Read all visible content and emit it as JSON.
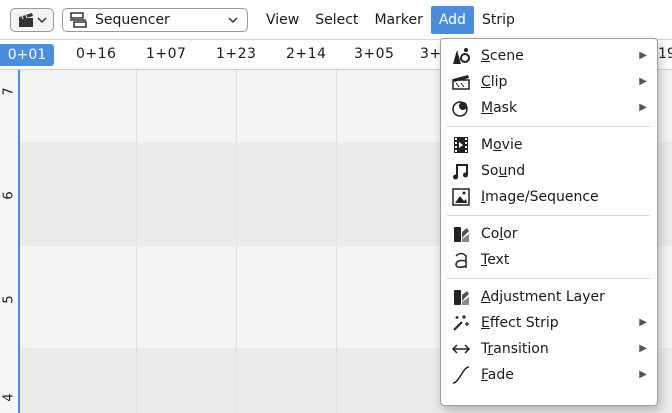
{
  "header": {
    "editor_type_icon": "clapperboard-icon",
    "mode_icon": "sequencer-icon",
    "mode_label": "Sequencer",
    "menus": [
      "View",
      "Select",
      "Marker",
      "Add",
      "Strip"
    ],
    "active_menu": "Add"
  },
  "ruler": {
    "current": "0+01",
    "frames": [
      "0+16",
      "1+07",
      "1+23",
      "2+14",
      "3+05",
      "3+",
      "19"
    ]
  },
  "channels": [
    "7",
    "6",
    "5",
    "4"
  ],
  "menu": {
    "items": [
      {
        "label_pre": "",
        "label_u": "S",
        "label_post": "cene",
        "icon": "scene-icon",
        "submenu": true
      },
      {
        "label_pre": "",
        "label_u": "C",
        "label_post": "lip",
        "icon": "clip-icon",
        "submenu": true
      },
      {
        "label_pre": "",
        "label_u": "M",
        "label_post": "ask",
        "icon": "mask-icon",
        "submenu": true
      },
      {
        "sep": true
      },
      {
        "label_pre": "M",
        "label_u": "o",
        "label_post": "vie",
        "icon": "movie-icon",
        "submenu": false
      },
      {
        "label_pre": "So",
        "label_u": "u",
        "label_post": "nd",
        "icon": "sound-icon",
        "submenu": false
      },
      {
        "label_pre": "",
        "label_u": "I",
        "label_post": "mage/Sequence",
        "icon": "image-icon",
        "submenu": false
      },
      {
        "sep": true
      },
      {
        "label_pre": "Co",
        "label_u": "l",
        "label_post": "or",
        "icon": "color-icon",
        "submenu": false
      },
      {
        "label_pre": "",
        "label_u": "T",
        "label_post": "ext",
        "icon": "text-icon",
        "submenu": false
      },
      {
        "sep": true
      },
      {
        "label_pre": "",
        "label_u": "A",
        "label_post": "djustment Layer",
        "icon": "adjustment-icon",
        "submenu": false
      },
      {
        "label_pre": "",
        "label_u": "E",
        "label_post": "ffect Strip",
        "icon": "effect-icon",
        "submenu": true
      },
      {
        "label_pre": "T",
        "label_u": "r",
        "label_post": "ansition",
        "icon": "transition-icon",
        "submenu": true
      },
      {
        "label_pre": "",
        "label_u": "F",
        "label_post": "ade",
        "icon": "fade-icon",
        "submenu": true
      }
    ]
  },
  "colors": {
    "accent": "#4c8dde"
  }
}
